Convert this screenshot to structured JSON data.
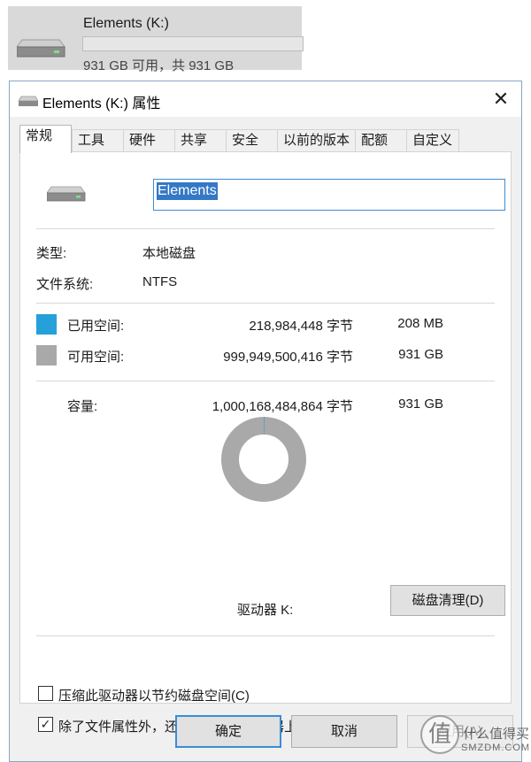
{
  "drive_tile": {
    "name": "Elements (K:)",
    "free_text": "931 GB 可用，共 931 GB",
    "used_fraction": 0.0002
  },
  "dialog": {
    "title": "Elements (K:) 属性",
    "close_glyph": "✕",
    "tabs": [
      "常规",
      "工具",
      "硬件",
      "共享",
      "安全",
      "以前的版本",
      "配额",
      "自定义"
    ],
    "active_tab": "常规",
    "general": {
      "volume_name": "Elements",
      "type_label": "类型:",
      "type_value": "本地磁盘",
      "fs_label": "文件系统:",
      "fs_value": "NTFS",
      "used": {
        "label": "已用空间:",
        "bytes": "218,984,448 字节",
        "size": "208 MB",
        "color": "#26a0da"
      },
      "free": {
        "label": "可用空间:",
        "bytes": "999,949,500,416 字节",
        "size": "931 GB",
        "color": "#a9a9a9"
      },
      "capacity": {
        "label": "容量:",
        "bytes": "1,000,168,484,864 字节",
        "size": "931 GB"
      },
      "used_fraction": 0.0002,
      "drive_label": "驱动器 K:",
      "cleanup_label": "磁盘清理(D)",
      "compress_label": "压缩此驱动器以节约磁盘空间(C)",
      "compress_checked": false,
      "index_label": "除了文件属性外，还允许索引此驱动器上文件的内容(I)",
      "index_checked": true
    },
    "buttons": {
      "ok": "确定",
      "cancel": "取消",
      "apply": "应用(A)"
    }
  },
  "watermark": {
    "logo_glyph": "值",
    "text_top": "什么值得买",
    "text_bottom": "SMZDM.COM"
  }
}
